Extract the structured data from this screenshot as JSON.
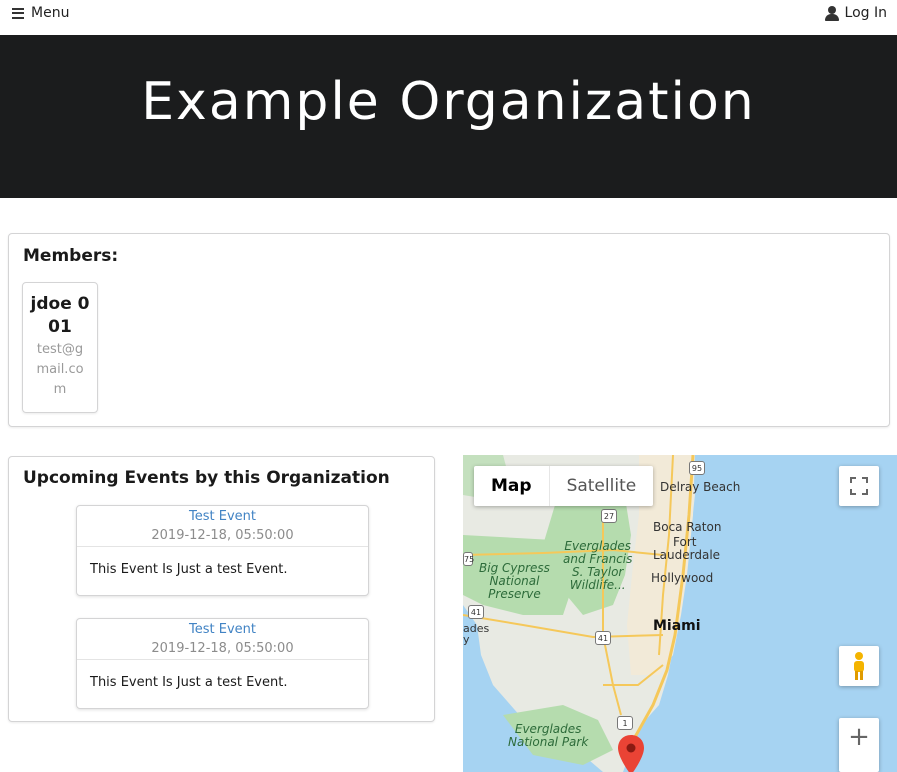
{
  "topbar": {
    "menu_label": "Menu",
    "login_label": "Log In"
  },
  "hero": {
    "title": "Example Organization"
  },
  "members": {
    "heading": "Members:",
    "items": [
      {
        "name": "jdoe 001",
        "email": "test@gmail.com"
      }
    ]
  },
  "events": {
    "heading": "Upcoming Events by this Organization",
    "items": [
      {
        "title": "Test Event",
        "datetime": "2019-12-18, 05:50:00",
        "description": "This Event Is Just a test Event."
      },
      {
        "title": "Test Event",
        "datetime": "2019-12-18, 05:50:00",
        "description": "This Event Is Just a test Event."
      }
    ]
  },
  "map": {
    "type_map": "Map",
    "type_satellite": "Satellite",
    "places": {
      "delray": "Delray Beach",
      "boca": "Boca Raton",
      "fort_lauderdale_1": "Fort",
      "fort_lauderdale_2": "Lauderdale",
      "hollywood": "Hollywood",
      "miami": "Miami",
      "everglades_wma_1": "Everglades",
      "everglades_wma_2": "and Francis",
      "everglades_wma_3": "S. Taylor",
      "everglades_wma_4": "Wildlife...",
      "big_cypress_1": "Big Cypress",
      "big_cypress_2": "National",
      "big_cypress_3": "Preserve",
      "everglades_np_1": "Everglades",
      "everglades_np_2": "National Park",
      "glades_partial_1": "ades",
      "glades_partial_2": "y"
    },
    "shields": {
      "i95": "95",
      "r27": "27",
      "r41a": "41",
      "r41b": "41",
      "r1": "1",
      "i75": "75"
    },
    "zoom_in_label": "+",
    "colors": {
      "water": "#a6d3f2",
      "land": "#e8eae3",
      "park": "#b5dcae",
      "urban": "#f2ead8",
      "road": "#f5c85a",
      "marker": "#ea4335"
    }
  }
}
